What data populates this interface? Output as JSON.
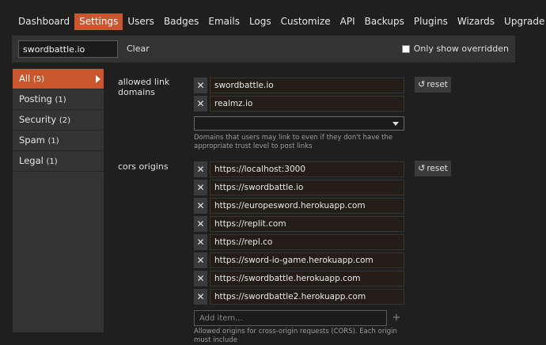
{
  "nav": {
    "tabs": [
      "Dashboard",
      "Settings",
      "Users",
      "Badges",
      "Emails",
      "Logs",
      "Customize",
      "API",
      "Backups",
      "Plugins",
      "Wizards",
      "Upgrade"
    ],
    "active_tab": "Settings"
  },
  "filter": {
    "value": "swordbattle.io",
    "clear_label": "Clear",
    "only_overridden_label": "Only show overridden"
  },
  "sidebar": {
    "items": [
      {
        "label": "All",
        "count": "(5)"
      },
      {
        "label": "Posting",
        "count": "(1)"
      },
      {
        "label": "Security",
        "count": "(2)"
      },
      {
        "label": "Spam",
        "count": "(1)"
      },
      {
        "label": "Legal",
        "count": "(1)"
      }
    ]
  },
  "settings": {
    "allowed_link_domains": {
      "label": "allowed link domains",
      "values": [
        "swordbattle.io",
        "realmz.io"
      ],
      "reset_label": "reset",
      "description": "Domains that users may link to even if they don't have the appropriate trust level to post links"
    },
    "cors_origins": {
      "label": "cors origins",
      "values": [
        "https://localhost:3000",
        "https://swordbattle.io",
        "https://europesword.herokuapp.com",
        "https://replit.com",
        "https://repl.co",
        "https://sword-io-game.herokuapp.com",
        "https://swordbattle.herokuapp.com",
        "https://swordbattle2.herokuapp.com"
      ],
      "reset_label": "reset",
      "add_placeholder": "Add item...",
      "description": "Allowed origins for cross-origin requests (CORS). Each origin must include"
    }
  },
  "icons": {
    "remove": "close-icon",
    "reset": "undo-icon",
    "add": "plus-icon",
    "caret": "chevron-down-icon",
    "sidebar_active": "chevron-right-icon"
  },
  "colors": {
    "accent": "#c9562d",
    "background": "#1f1f1f",
    "panel": "#333333"
  }
}
